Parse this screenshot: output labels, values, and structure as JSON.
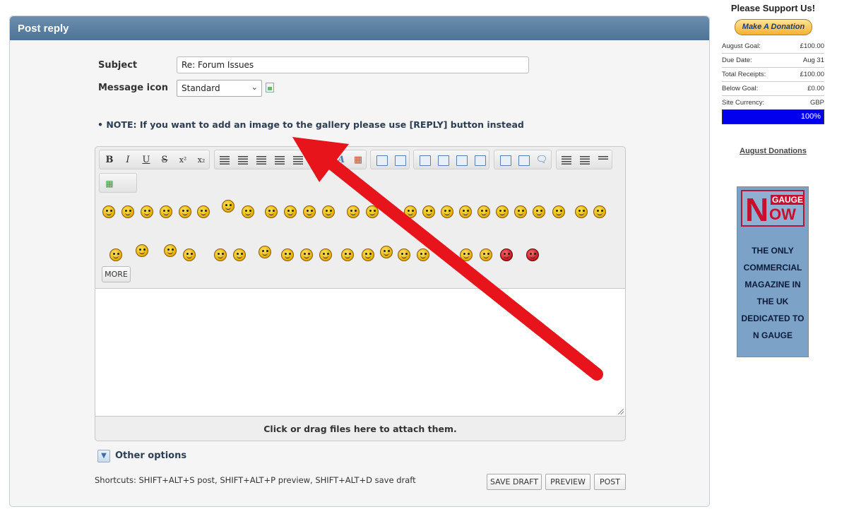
{
  "post_reply": {
    "title": "Post reply",
    "subject_label": "Subject",
    "subject_value": "Re: Forum Issues",
    "message_icon_label": "Message icon",
    "message_icon_value": "Standard",
    "note": "• NOTE: If you want to add an image to the gallery please use [REPLY] button instead",
    "more_label": "MORE",
    "attach_text": "Click or drag files here to attach them.",
    "other_options": "Other options",
    "shortcuts": "Shortcuts: SHIFT+ALT+S post, SHIFT+ALT+P preview, SHIFT+ALT+D save draft",
    "buttons": {
      "save_draft": "SAVE DRAFT",
      "preview": "PREVIEW",
      "post": "POST"
    }
  },
  "toolbar": {
    "bold": "B",
    "italic": "I",
    "underline": "U",
    "strike": "S",
    "sup": "x²",
    "sub": "x₂"
  },
  "annotation": {
    "arrow_color": "#e8141c"
  },
  "sidebar": {
    "support_title": "Please Support Us!",
    "donate_button": "Make A Donation",
    "rows": [
      {
        "k": "August Goal:",
        "v": "£100.00"
      },
      {
        "k": "Due Date:",
        "v": "Aug 31"
      },
      {
        "k": "Total Receipts:",
        "v": "£100.00"
      },
      {
        "k": "Below Goal:",
        "v": "£0.00"
      },
      {
        "k": "Site Currency:",
        "v": "GBP"
      }
    ],
    "progress_percent": 100,
    "progress_label": "100%",
    "august_donations": "August Donations",
    "ad": {
      "logo_n": "N",
      "logo_gauge": "GAUGE",
      "logo_now": "OW",
      "lines": [
        "THE ONLY",
        "COMMERCIAL",
        "MAGAZINE IN",
        "THE UK",
        "DEDICATED TO",
        "N GAUGE"
      ]
    }
  }
}
